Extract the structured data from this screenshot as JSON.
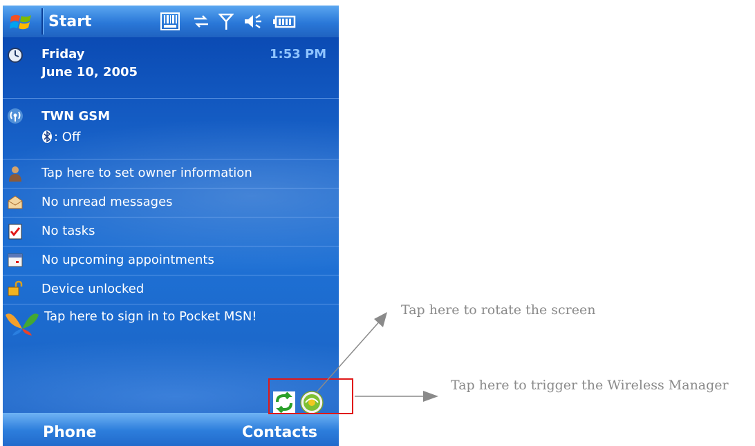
{
  "titlebar": {
    "title": "Start"
  },
  "today": {
    "date": {
      "day": "Friday",
      "date": "June 10, 2005",
      "time": "1:53 PM"
    },
    "network": {
      "carrier": "TWN GSM",
      "bluetooth": ": Off"
    },
    "owner": "Tap here to set owner information",
    "messages": "No unread messages",
    "tasks": "No tasks",
    "appointments": "No upcoming appointments",
    "device": "Device unlocked",
    "msn": "Tap here to sign in to Pocket MSN!"
  },
  "menubar": {
    "left": "Phone",
    "right": "Contacts"
  },
  "annotations": {
    "rotate": "Tap here to rotate the screen",
    "wireless": "Tap here to trigger the Wireless Manager"
  },
  "colors": {
    "highlight_box": "#e01818",
    "annotation_text": "#8a8a8a"
  }
}
